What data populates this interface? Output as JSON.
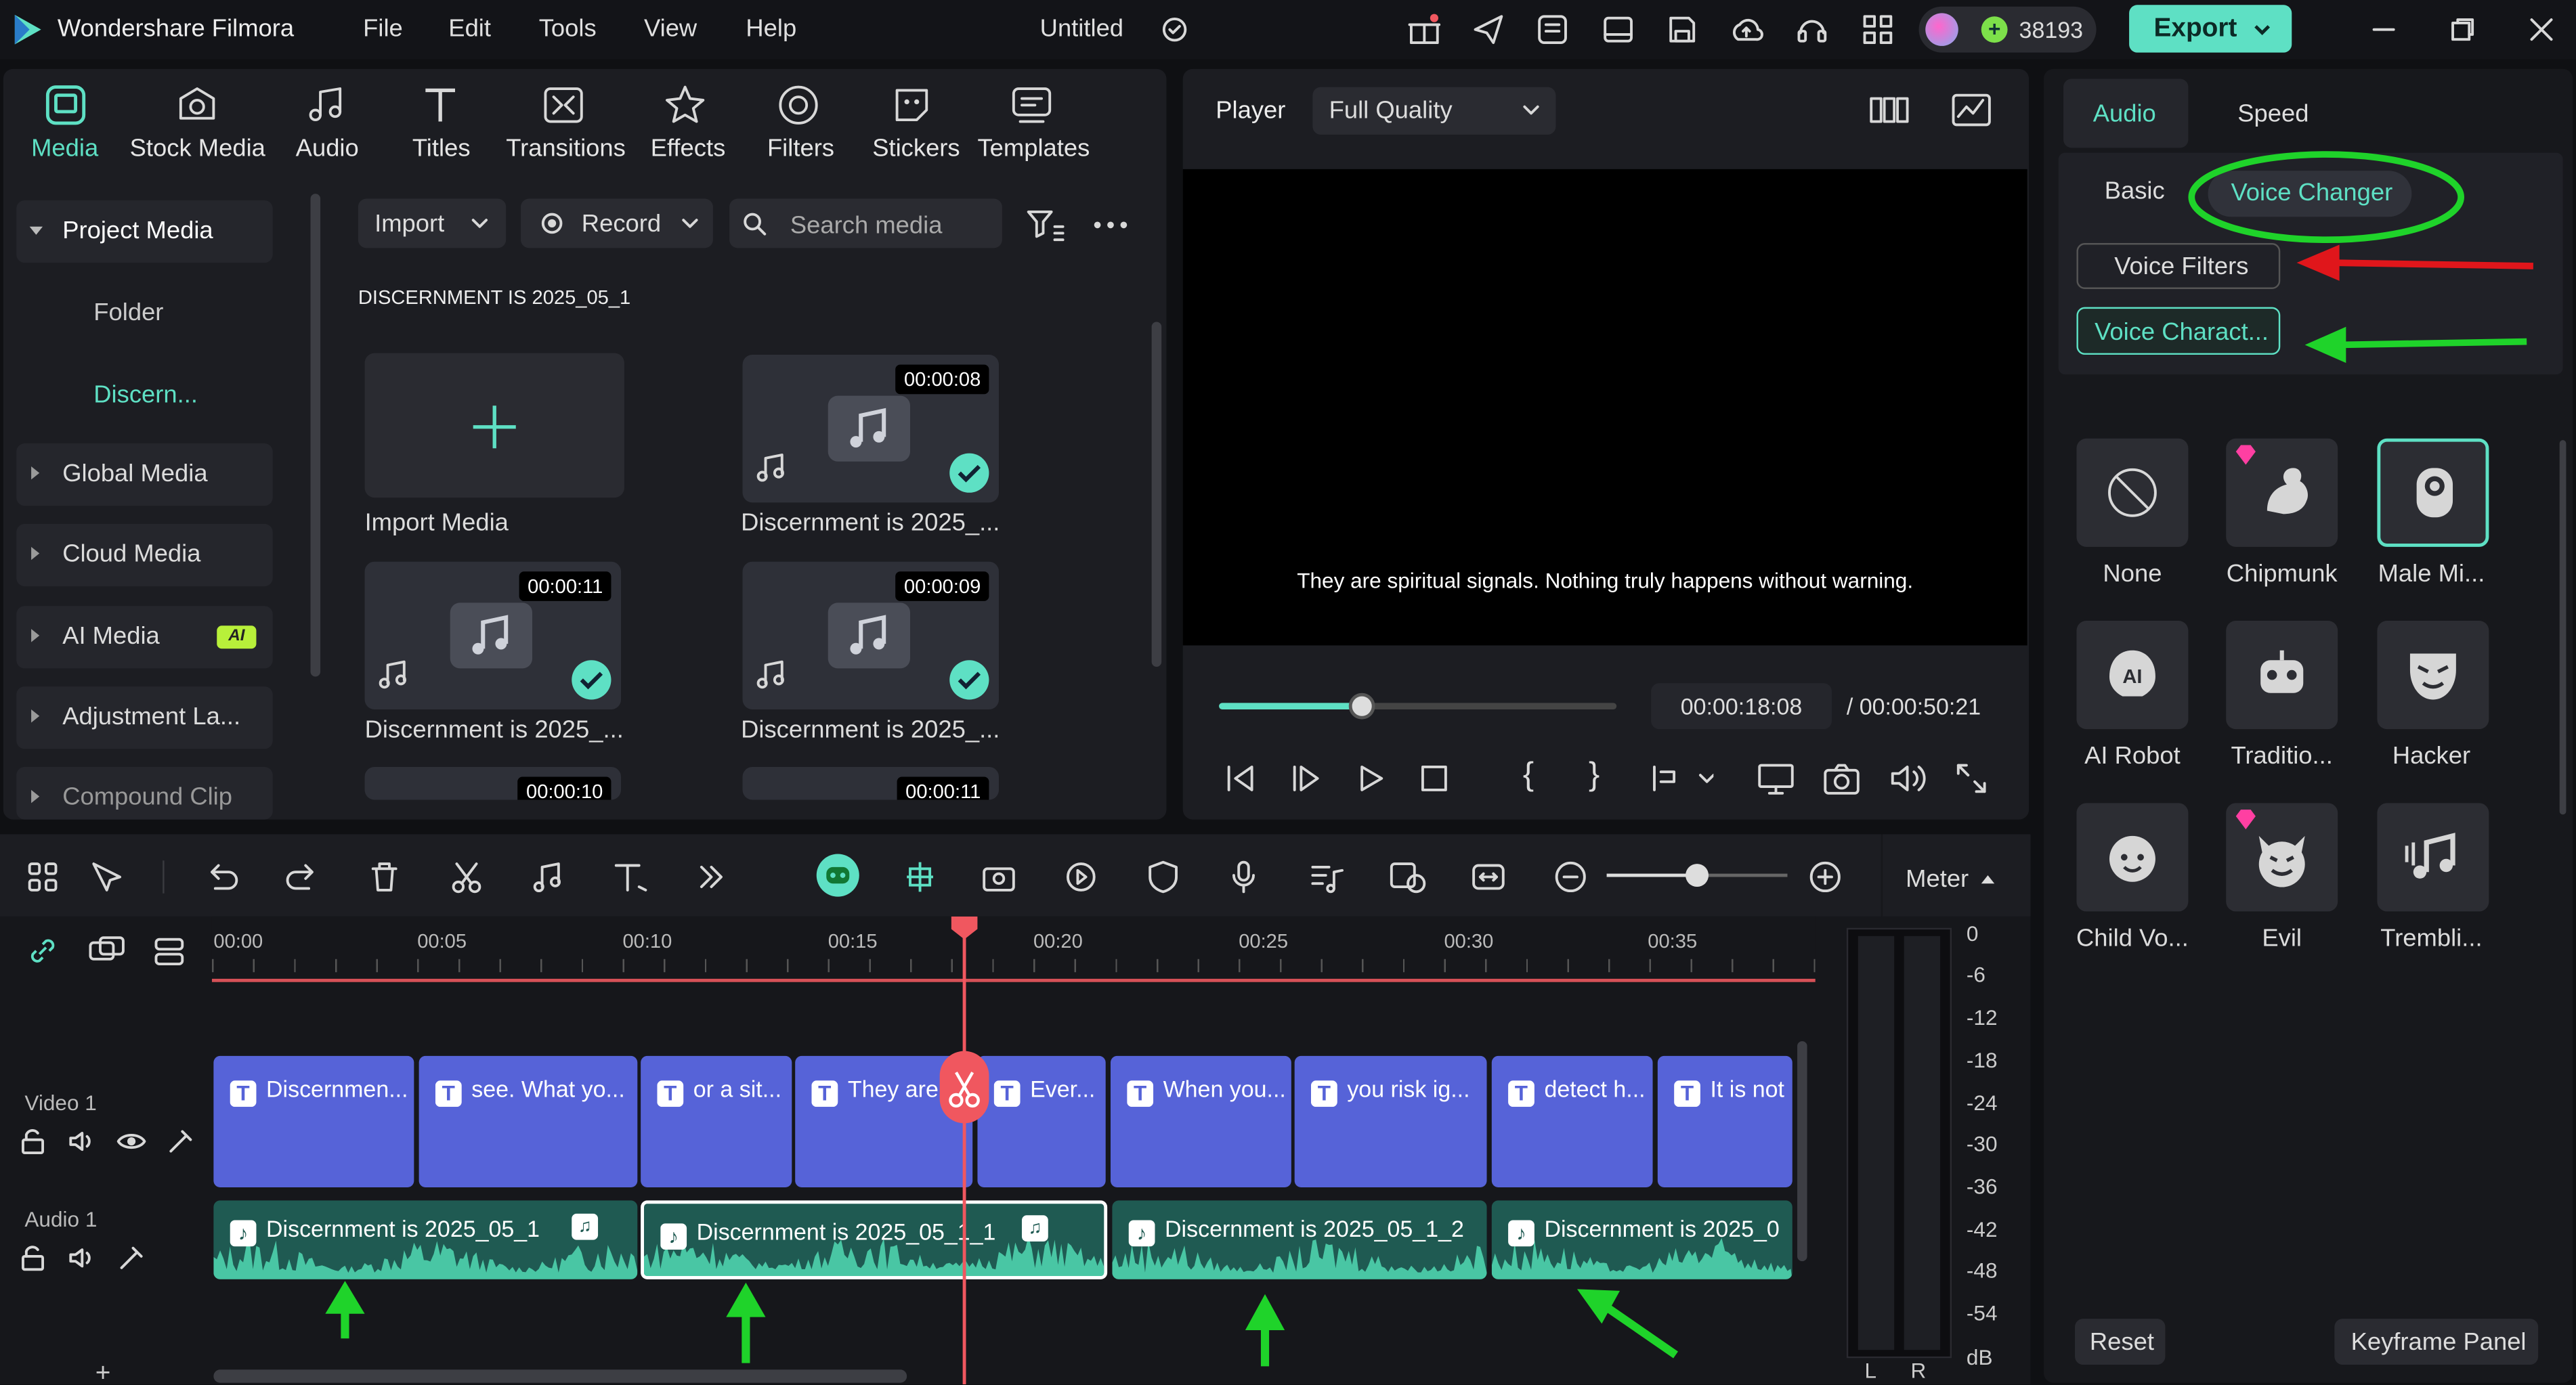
{
  "app": {
    "name": "Wondershare Filmora",
    "doc_title": "Untitled",
    "credits": "38193",
    "export_label": "Export"
  },
  "menu": [
    "File",
    "Edit",
    "Tools",
    "View",
    "Help"
  ],
  "tabs": [
    {
      "label": "Media",
      "icon": "media-icon"
    },
    {
      "label": "Stock Media",
      "icon": "stock-media-icon"
    },
    {
      "label": "Audio",
      "icon": "audio-icon"
    },
    {
      "label": "Titles",
      "icon": "titles-icon"
    },
    {
      "label": "Transitions",
      "icon": "transitions-icon"
    },
    {
      "label": "Effects",
      "icon": "effects-icon"
    },
    {
      "label": "Filters",
      "icon": "filters-icon"
    },
    {
      "label": "Stickers",
      "icon": "stickers-icon"
    },
    {
      "label": "Templates",
      "icon": "templates-icon"
    }
  ],
  "sidebar": {
    "items": [
      "Project Media",
      "Folder",
      "Discern...",
      "Global Media",
      "Cloud Media",
      "AI Media",
      "Adjustment La...",
      "Compound Clip"
    ],
    "ai_badge": "AI"
  },
  "media": {
    "import_label": "Import",
    "record_label": "Record",
    "search_placeholder": "Search media",
    "folder_title": "DISCERNMENT IS  2025_05_1",
    "items": [
      {
        "label": "Import Media",
        "duration": ""
      },
      {
        "label": "Discernment is  2025_...",
        "duration": "00:00:08"
      },
      {
        "label": "Discernment is  2025_...",
        "duration": "00:00:11"
      },
      {
        "label": "Discernment is  2025_...",
        "duration": "00:00:09"
      },
      {
        "label": "",
        "duration": "00:00:10"
      },
      {
        "label": "",
        "duration": "00:00:11"
      }
    ]
  },
  "player": {
    "label": "Player",
    "quality": "Full Quality",
    "subtitle": "They are spiritual signals. Nothing truly happens without warning.",
    "current_time": "00:00:18:08",
    "total_time": "/  00:00:50:21",
    "progress": 0.36
  },
  "right_panel": {
    "tab_audio": "Audio",
    "tab_speed": "Speed",
    "sub_basic": "Basic",
    "sub_voice_changer": "Voice Changer",
    "voice_filters": "Voice Filters",
    "voice_characters": "Voice Charact...",
    "voices": [
      "None",
      "Chipmunk",
      "Male Mi...",
      "AI Robot",
      "Traditio...",
      "Hacker",
      "Child Vo...",
      "Evil",
      "Trembli..."
    ],
    "reset_label": "Reset",
    "keyframe_label": "Keyframe Panel"
  },
  "timeline": {
    "meter_label": "Meter",
    "ruler": [
      "00:00",
      "00:05",
      "00:10",
      "00:15",
      "00:20",
      "00:25",
      "00:30",
      "00:35"
    ],
    "video_track": "Video 1",
    "audio_track": "Audio 1",
    "video_clips": [
      "Discernmen...",
      "see. What yo...",
      "or a sit...",
      "They are",
      "Ever...",
      "When you...",
      "you risk ig...",
      "detect h...",
      "It is not"
    ],
    "audio_clips": [
      "Discernment is  2025_05_1",
      "Discernment is  2025_05_1_1",
      "Discernment is  2025_05_1_2",
      "Discernment is  2025_0"
    ],
    "db_scale": [
      "0",
      "-6",
      "-12",
      "-18",
      "-24",
      "-30",
      "-36",
      "-42",
      "-48",
      "-54",
      "dB"
    ],
    "lr": [
      "L",
      "R"
    ]
  },
  "colors": {
    "accent": "#5ee0c4",
    "clip_video": "#5663d8",
    "clip_audio": "#1f5a52",
    "playhead": "#f0575f",
    "annot_green": "#1fd32a",
    "annot_red": "#e0161b"
  }
}
